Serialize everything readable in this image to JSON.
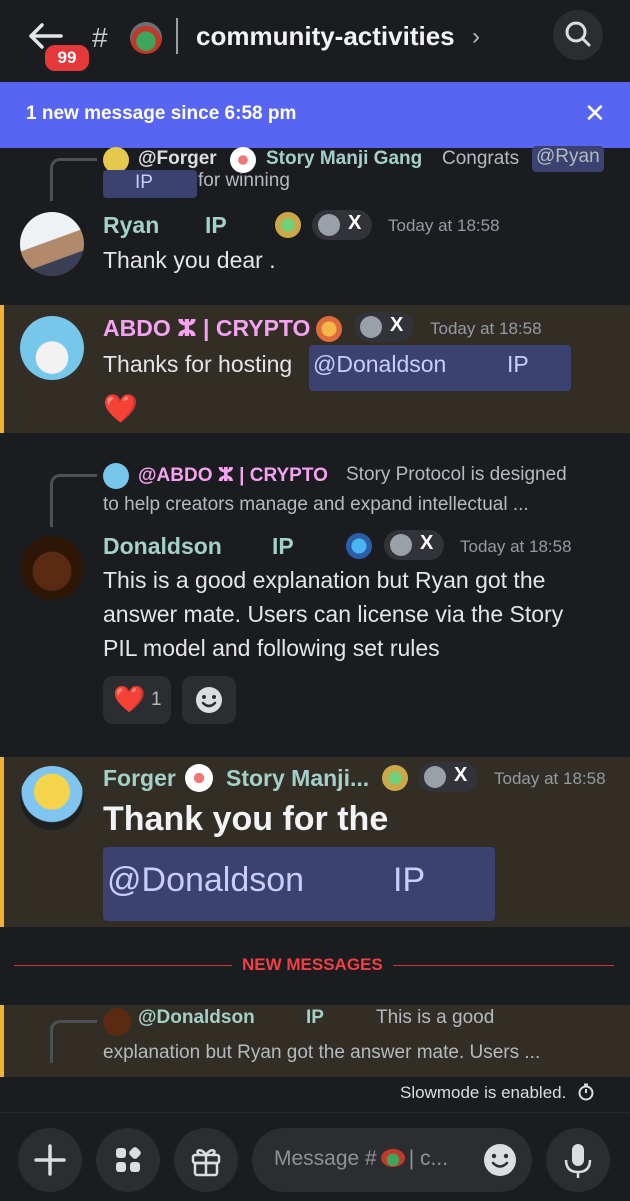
{
  "header": {
    "back_badge": "99",
    "channel_name": "community-activities",
    "chevron": "›"
  },
  "banner": {
    "text": "1 new message since 6:58 pm",
    "close": "✕"
  },
  "messages": [
    {
      "reply": {
        "author": "@Forger",
        "server": "Story Manji Gang",
        "text_prefix": "Congrats",
        "mention": "@Ryan",
        "mention_tail": "IP",
        "text_suffix": "for winning"
      },
      "author": "Ryan",
      "author_suffix": "IP",
      "tag": "X",
      "time": "Today at 18:58",
      "text": "Thank you dear ."
    },
    {
      "author": "ABDO ⵣ | CRYPTO",
      "tag": "X",
      "time": "Today at 18:58",
      "text": "Thanks for hosting",
      "mention": "@Donaldson",
      "mention_suffix": "IP",
      "emoji": "❤️"
    },
    {
      "reply": {
        "author": "@ABDO ⵣ | CRYPTO",
        "line1": "Story Protocol is designed",
        "line2": "to help creators manage and expand intellectual ..."
      },
      "author": "Donaldson",
      "author_suffix": "IP",
      "tag": "X",
      "time": "Today at 18:58",
      "lines": [
        "This is a good explanation but Ryan got the",
        "answer mate.  Users can license via the  Story",
        "PIL model and following set rules"
      ],
      "reaction_emoji": "❤️",
      "reaction_count": "1"
    },
    {
      "author": "Forger",
      "server": "Story Manji...",
      "tag": "X",
      "time": "Today at 18:58",
      "big_text": "Thank you for the",
      "mention": "@Donaldson",
      "mention_suffix": "IP"
    }
  ],
  "new_messages_label": "NEW MESSAGES",
  "last_reply": {
    "author": "@Donaldson",
    "author_suffix": "IP",
    "line1": "This is a good",
    "line2": "explanation but Ryan got the answer mate.  Users ..."
  },
  "slowmode": "Slowmode is enabled.",
  "composer": {
    "placeholder": "Message #",
    "placeholder_tail": "| c..."
  },
  "colors": {
    "accent": "#5865f2",
    "highlight_bar": "#f0b232",
    "new_messages": "#f23f43",
    "abdo_name": "#f3a3f0",
    "teal_name": "#a3d0c8"
  }
}
